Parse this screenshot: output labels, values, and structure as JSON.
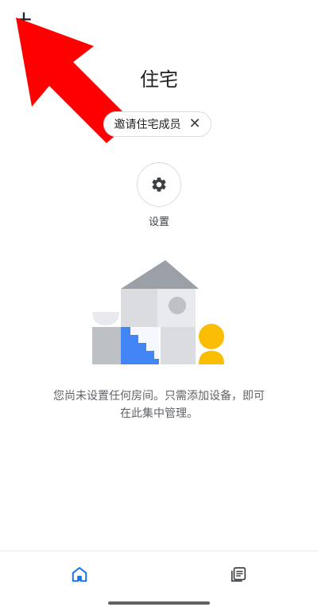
{
  "header": {
    "add_symbol": "+",
    "title": "住宅"
  },
  "invite_chip": {
    "label": "邀请住宅成员",
    "close_symbol": "✕"
  },
  "settings": {
    "label": "设置",
    "icon": "gear-icon"
  },
  "empty_state": {
    "line1": "您尚未设置任何房间。只需添加设备，即可",
    "line2": "在此集中管理。"
  },
  "bottom_nav": {
    "home_icon": "home-icon",
    "feed_icon": "feed-icon",
    "active_color": "#1a73e8"
  },
  "colors": {
    "annotation_arrow": "#ff0000",
    "illustration_blue": "#4285f4",
    "illustration_yellow": "#fbbc04",
    "illustration_gray": "#bdc1c6"
  }
}
